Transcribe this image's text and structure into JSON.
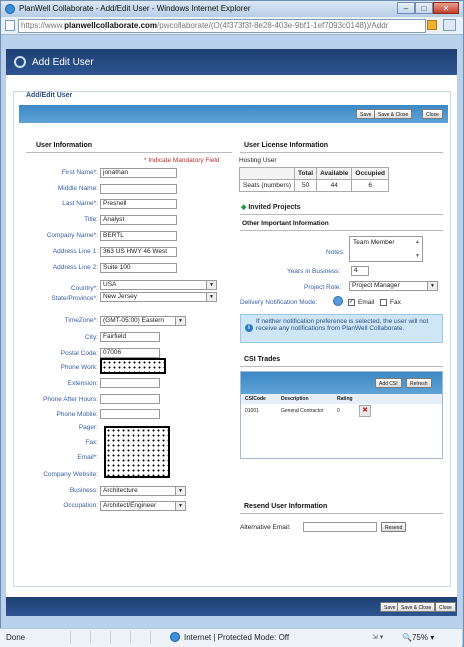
{
  "window": {
    "title": "PlanWell Collaborate - Add/Edit User - Windows Internet Explorer",
    "url_prefix": "https://www.",
    "url_domain": "planwellcollaborate.com",
    "url_rest": "/pwcollaborate/(O(4f373f3f-8e28-403e-9bf1-1ef7093c0148))/Addr",
    "minimize": "–",
    "maximize": "□",
    "close": "✕"
  },
  "app": {
    "header_title": "Add Edit User"
  },
  "panel": {
    "title": "Add/Edit User"
  },
  "toolbar": {
    "save": "Save",
    "save_close": "Save & Close",
    "close": "Close"
  },
  "user_info": {
    "heading": "User Information",
    "mandatory_note": "* Indicate Mandatory Field",
    "fields": {
      "first_name_label": "First Name*:",
      "first_name": "jonathan",
      "middle_name_label": "Middle Name:",
      "middle_name": "",
      "last_name_label": "Last Name*:",
      "last_name": "Presnell",
      "title_label": "Title:",
      "title": "Analyst",
      "company_label": "Company Name*:",
      "company": "BERTL",
      "address1_label": "Address Line 1:",
      "address1": "363 US HWY 46 West",
      "address2_label": "Address Line 2:",
      "address2": "Suite 100",
      "country_label": "Country*:",
      "country": "USA",
      "state_label": "State/Province*:",
      "state": "New Jersey",
      "timezone_label": "TimeZone*:",
      "timezone": "(GMT-05:00) Eastern",
      "city_label": "City:",
      "city": "Fairfield",
      "postal_label": "Postal Code:",
      "postal": "07006",
      "phone_work_label": "Phone Work:",
      "extension_label": "Extension:",
      "phone_after_label": "Phone After Hours:",
      "phone_mobile_label": "Phone Mobile:",
      "pager_label": "Pager:",
      "fax_label": "Fax:",
      "email_label": "Email*:",
      "website_label": "Company Website:",
      "business_label": "Business:",
      "business": "Architecture",
      "occupation_label": "Occupation:",
      "occupation": "Architect/Engineer"
    }
  },
  "license": {
    "heading": "User License Information",
    "hosting_user": "Hosting User",
    "headers": [
      "",
      "Total",
      "Available",
      "Occupied"
    ],
    "row": [
      "Seats (numbers)",
      "50",
      "44",
      "6"
    ]
  },
  "invited_projects": "Invited Projects",
  "other_info": {
    "heading": "Other Important Information",
    "notes_label": "Notes:",
    "notes_value": "Team Member",
    "years_label": "Years in Business:",
    "years_value": "4",
    "project_role_label": "Project Role:",
    "project_role": "Project Manager",
    "delivery_label": "Delivery Notification Mode:",
    "email_option": "Email",
    "fax_option": "Fax",
    "info_text": "If neither notification preference is selected, the user will not receive any notifications from PlanWell Collaborate."
  },
  "csi": {
    "heading": "CSI Trades",
    "add_button": "Add CSI",
    "refresh_button": "Refresh",
    "columns": [
      "CSICode",
      "Description",
      "Rating"
    ],
    "row": [
      "01001",
      "General Contractor",
      "0"
    ]
  },
  "resend": {
    "heading": "Resend User Information",
    "alt_email_label": "Alternative Email:",
    "resend_button": "Resend"
  },
  "statusbar": {
    "done": "Done",
    "zone": "Internet | Protected Mode: Off",
    "zoom": "75%"
  }
}
